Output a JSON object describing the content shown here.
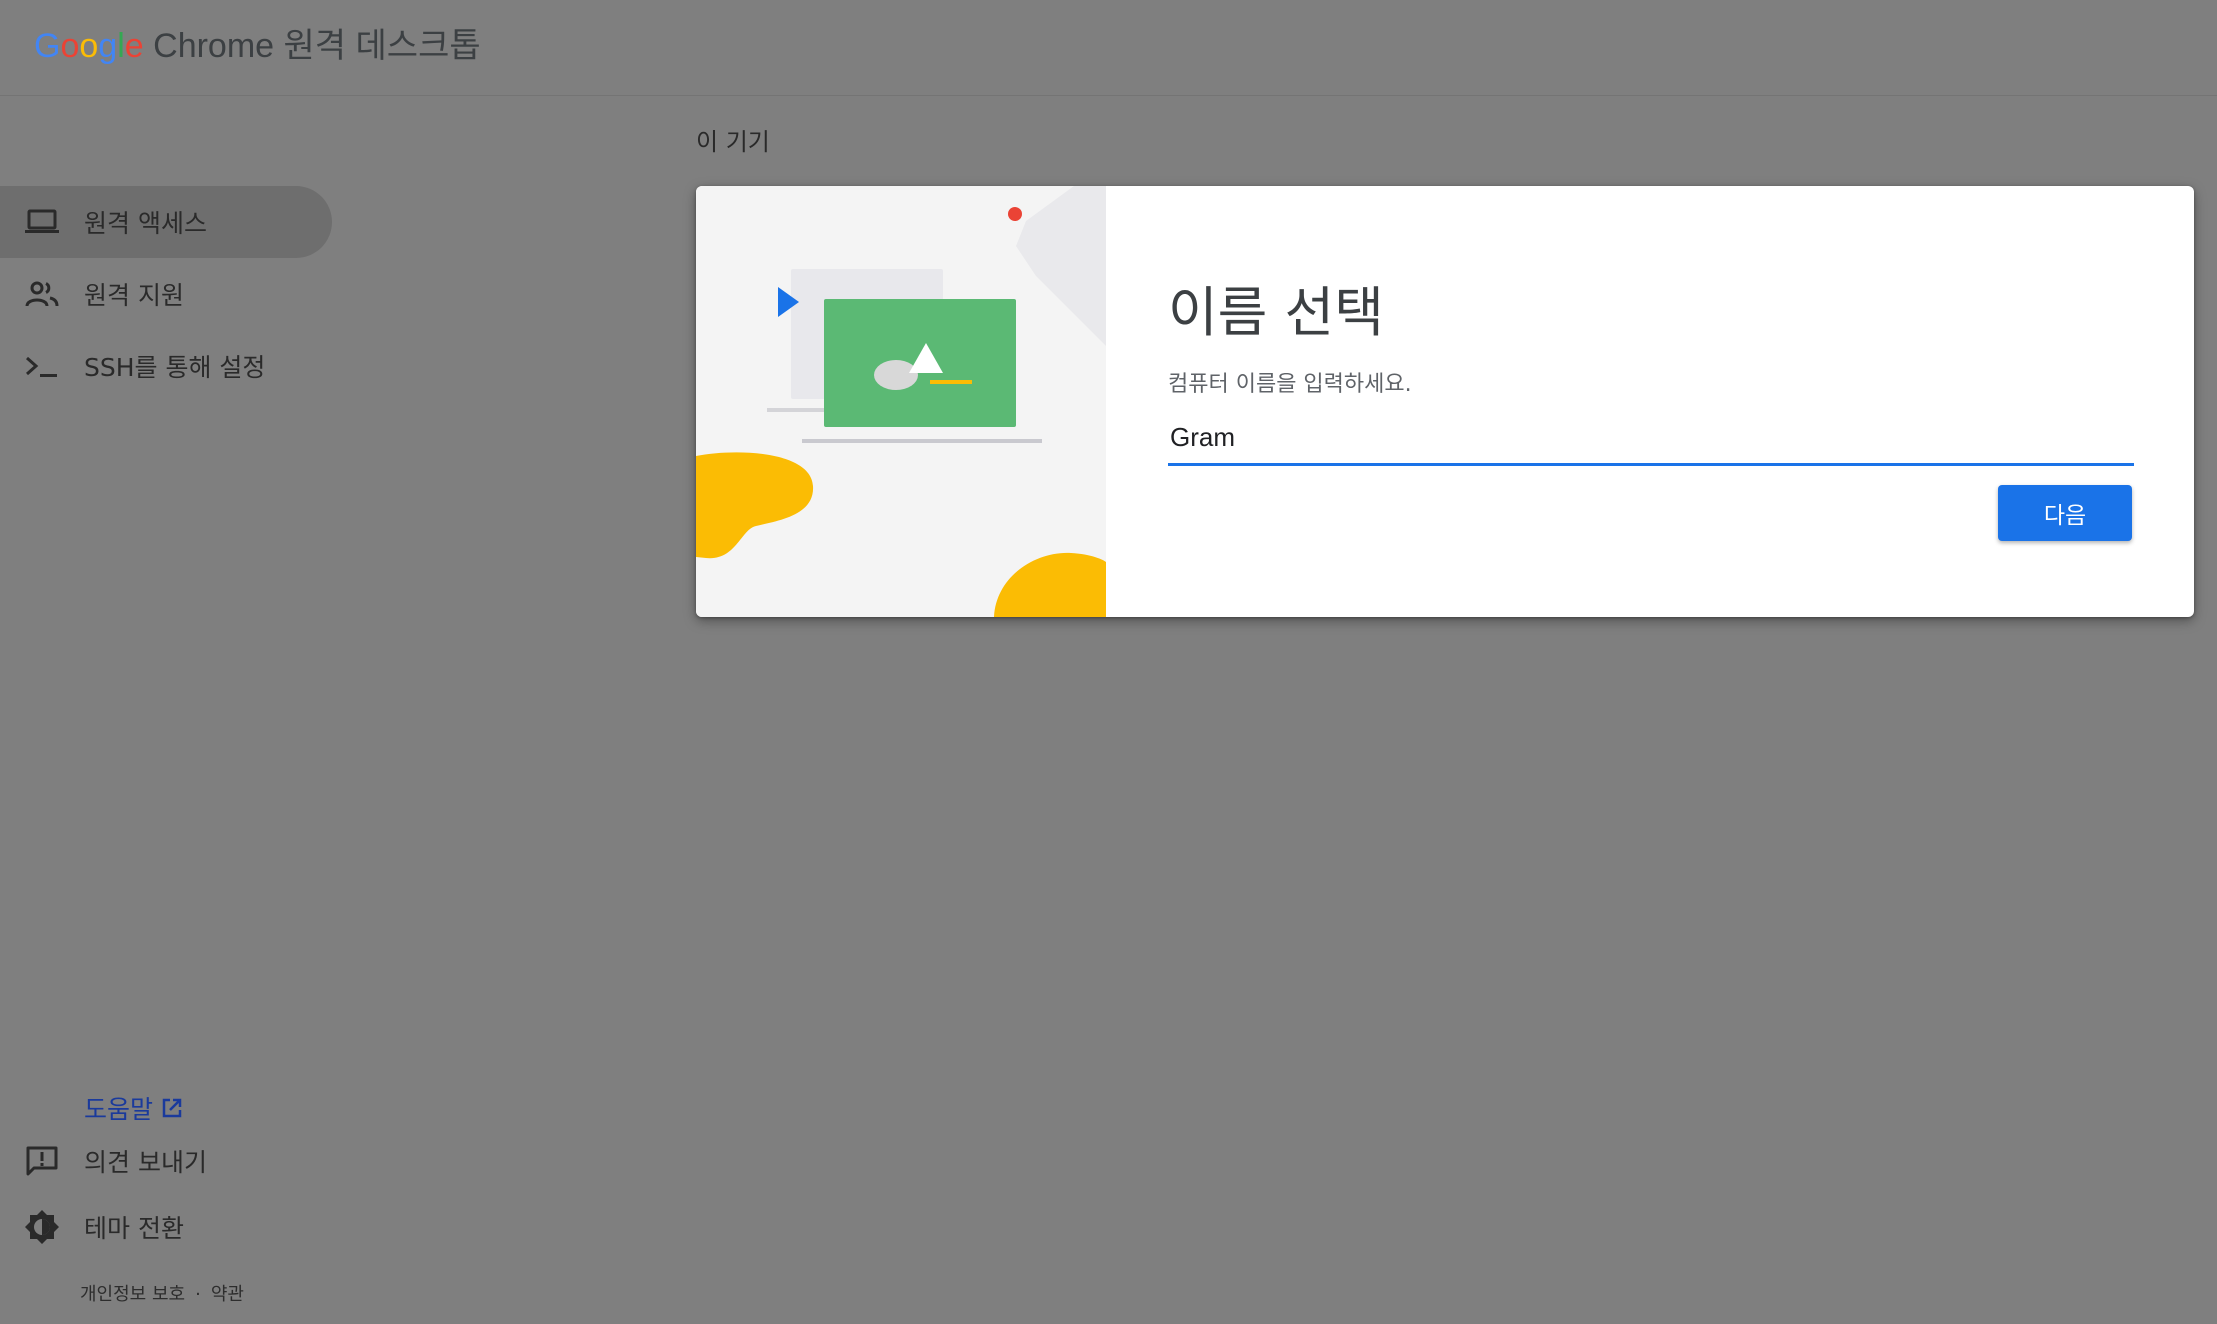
{
  "app": {
    "logo": {
      "google_letters": [
        "G",
        "o",
        "o",
        "g",
        "l",
        "e"
      ],
      "product_name": " Chrome 원격 데스크톱"
    }
  },
  "nav": {
    "items": [
      {
        "label": "원격 액세스",
        "icon": "laptop-icon",
        "active": true
      },
      {
        "label": "원격 지원",
        "icon": "people-icon",
        "active": false
      },
      {
        "label": "SSH를 통해 설정",
        "icon": "terminal-icon",
        "active": false
      }
    ]
  },
  "footer": {
    "help_label": "도움말",
    "feedback_label": "의견 보내기",
    "theme_label": "테마 전환",
    "privacy_label": "개인정보 보호",
    "separator": "·",
    "terms_label": "약관"
  },
  "main": {
    "section_title": "이 기기"
  },
  "dialog": {
    "title": "이름 선택",
    "subtitle": "컴퓨터 이름을 입력하세요.",
    "name_value": "Gram",
    "next_label": "다음"
  },
  "colors": {
    "accent": "#1a73e8",
    "backdrop": "#7f7f7f",
    "illus_green": "#5bb974",
    "illus_yellow": "#fbbc04",
    "illus_blue": "#1a73e8",
    "illus_red": "#ea4335"
  }
}
